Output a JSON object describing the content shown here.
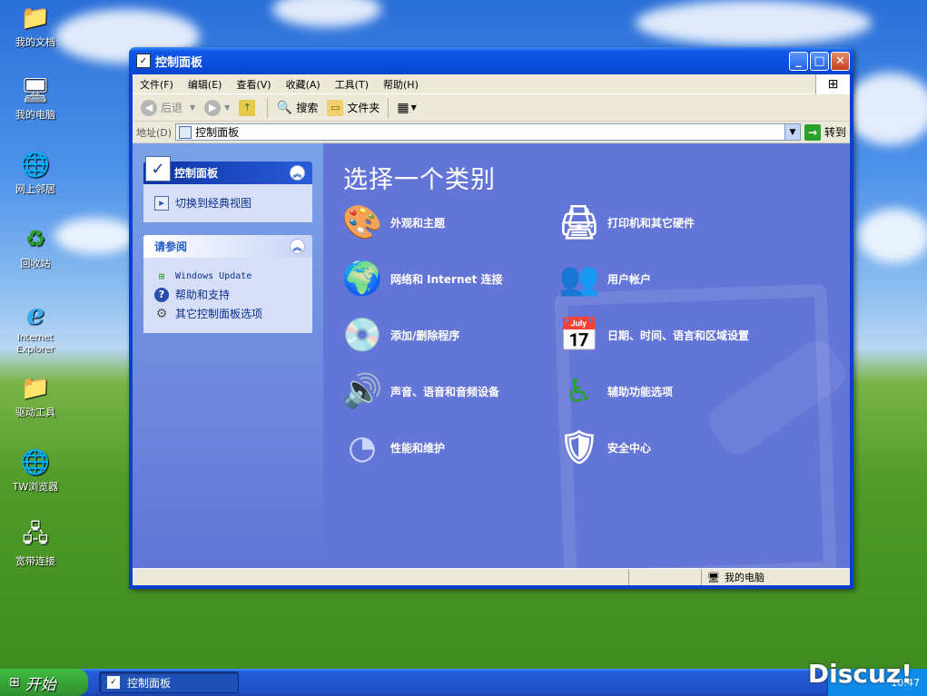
{
  "desktop": {
    "icons": [
      {
        "label": "我的文档",
        "icon": "folder-documents-icon",
        "glyph": "📁"
      },
      {
        "label": "我的电脑",
        "icon": "computer-icon",
        "glyph": "🖥"
      },
      {
        "label": "网上邻居",
        "icon": "network-icon",
        "glyph": "🌐"
      },
      {
        "label": "回收站",
        "icon": "recycle-bin-icon",
        "glyph": "♻"
      },
      {
        "label": "Internet Explorer",
        "icon": "internet-explorer-icon",
        "glyph": "e"
      },
      {
        "label": "驱动工具",
        "icon": "folder-icon",
        "glyph": "📁"
      },
      {
        "label": "TW浏览器",
        "icon": "browser-icon",
        "glyph": "🌐"
      },
      {
        "label": "宽带连接",
        "icon": "broadband-icon",
        "glyph": "🖧"
      }
    ]
  },
  "window": {
    "title": "控制面板",
    "menu": [
      "文件(F)",
      "编辑(E)",
      "查看(V)",
      "收藏(A)",
      "工具(T)",
      "帮助(H)"
    ],
    "toolbar": {
      "back": "后退",
      "search": "搜索",
      "folders": "文件夹"
    },
    "address": {
      "label": "地址(D)",
      "value": "控制面板",
      "go": "转到"
    },
    "sidebar": {
      "panel1_title": "控制面板",
      "panel1_link": "切换到经典视图",
      "panel2_title": "请参阅",
      "panel2_links": [
        "Windows Update",
        "帮助和支持",
        "其它控制面板选项"
      ]
    },
    "main": {
      "title": "选择一个类别",
      "categories": [
        {
          "label": "外观和主题",
          "icon": "appearance-themes-icon",
          "glyph": "🎨"
        },
        {
          "label": "打印机和其它硬件",
          "icon": "printer-hardware-icon",
          "glyph": "🖨"
        },
        {
          "label": "网络和 Internet 连接",
          "icon": "network-internet-icon",
          "glyph": "🌍"
        },
        {
          "label": "用户帐户",
          "icon": "user-accounts-icon",
          "glyph": "👥"
        },
        {
          "label": "添加/删除程序",
          "icon": "add-remove-programs-icon",
          "glyph": "💿"
        },
        {
          "label": "日期、时间、语言和区域设置",
          "icon": "date-time-region-icon",
          "glyph": "📅"
        },
        {
          "label": "声音、语音和音频设备",
          "icon": "sound-audio-icon",
          "glyph": "🔊"
        },
        {
          "label": "辅助功能选项",
          "icon": "accessibility-icon",
          "glyph": "♿"
        },
        {
          "label": "性能和维护",
          "icon": "performance-maintenance-icon",
          "glyph": "◔"
        },
        {
          "label": "安全中心",
          "icon": "security-center-icon",
          "glyph": "🛡"
        }
      ]
    },
    "status": {
      "location": "我的电脑"
    }
  },
  "taskbar": {
    "start": "开始",
    "task": "控制面板",
    "clock": "10:47"
  },
  "watermark": "Discuz!"
}
